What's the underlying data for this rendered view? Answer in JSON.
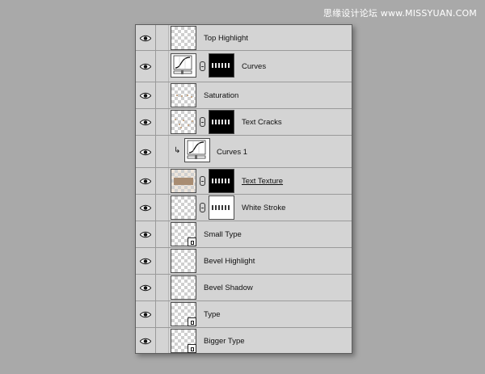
{
  "watermark": "思缘设计论坛 www.MISSYUAN.COM",
  "layers": [
    {
      "name": "Top Highlight"
    },
    {
      "name": "Curves"
    },
    {
      "name": "Saturation"
    },
    {
      "name": "Text Cracks"
    },
    {
      "name": "Curves 1"
    },
    {
      "name": "Text Texture"
    },
    {
      "name": "White Stroke"
    },
    {
      "name": "Small Type"
    },
    {
      "name": "Bevel Highlight"
    },
    {
      "name": "Bevel Shadow"
    },
    {
      "name": "Type"
    },
    {
      "name": "Bigger Type"
    }
  ]
}
